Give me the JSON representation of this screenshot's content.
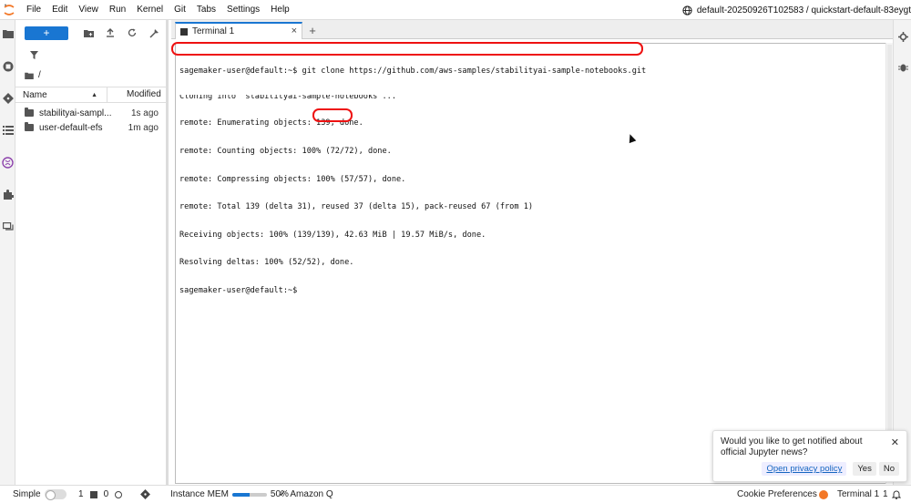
{
  "menubar": {
    "items": [
      "File",
      "Edit",
      "View",
      "Run",
      "Kernel",
      "Git",
      "Tabs",
      "Settings",
      "Help"
    ],
    "session": "default-20250926T102583 / quickstart-default-83eygt"
  },
  "filebrowser": {
    "new_label": "+",
    "path": "/",
    "columns": {
      "name": "Name",
      "modified": "Modified"
    },
    "rows": [
      {
        "name": "stabilityai-sampl...",
        "modified": "1s ago"
      },
      {
        "name": "user-default-efs",
        "modified": "1m ago"
      }
    ]
  },
  "tabs": [
    {
      "label": "Terminal 1"
    }
  ],
  "terminal": {
    "lines": [
      "sagemaker-user@default:~$ git clone https://github.com/aws-samples/stabilityai-sample-notebooks.git",
      "Cloning into 'stabilityai-sample-notebooks'...",
      "remote: Enumerating objects: 139, done.",
      "remote: Counting objects: 100% (72/72), done.",
      "remote: Compressing objects: 100% (57/57), done.",
      "remote: Total 139 (delta 31), reused 37 (delta 15), pack-reused 67 (from 1)",
      "Receiving objects: 100% (139/139), 42.63 MiB | 19.57 MiB/s, done.",
      "Resolving deltas: 100% (52/52), done.",
      "sagemaker-user@default:~$"
    ]
  },
  "statusbar": {
    "mode": "Simple",
    "kernels": "1",
    "terminals": "0",
    "mem_label": "Instance MEM",
    "mem_percent": "50%",
    "mem_fraction": 0.5,
    "amazon_q": "Amazon Q",
    "cookie": "Cookie Preferences",
    "active": "Terminal 1",
    "notifications": "1"
  },
  "toast": {
    "message": "Would you like to get notified about official Jupyter news?",
    "privacy": "Open privacy policy",
    "yes": "Yes",
    "no": "No"
  },
  "colors": {
    "accent": "#1976d2",
    "highlight": "#e11111"
  }
}
